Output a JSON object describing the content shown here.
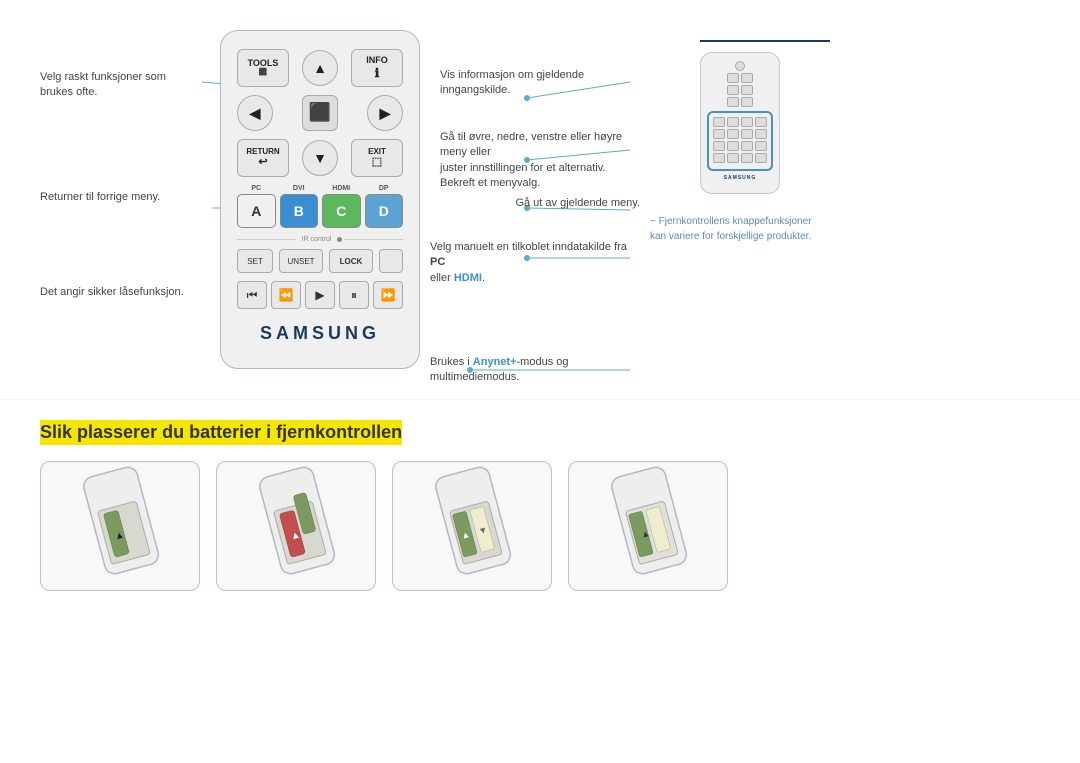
{
  "page": {
    "background": "#ffffff"
  },
  "remote": {
    "tools_label": "TOOLS",
    "info_label": "INFO",
    "return_label": "RETURN",
    "exit_label": "EXIT",
    "samsung_logo": "SAMSUNG",
    "ir_label": "IR control",
    "set_label": "SET",
    "unset_label": "UNSET",
    "lock_label": "LOCK",
    "color_buttons": [
      {
        "label": "PC",
        "letter": "A"
      },
      {
        "label": "DVI",
        "letter": "B"
      },
      {
        "label": "HDMI",
        "letter": "C"
      },
      {
        "label": "DP",
        "letter": "D"
      }
    ]
  },
  "annotations": [
    {
      "id": "tools",
      "text": "Velg raskt funksjoner som brukes ofte."
    },
    {
      "id": "info",
      "text": "Vis informasjon om gjeldende inngangskilde."
    },
    {
      "id": "navigate",
      "text": "Gå til øvre, nedre, venstre eller høyre meny eller\njuster innstillingen for et alternativ.\nBekreft et menyvalg."
    },
    {
      "id": "exit",
      "text": "Gå ut av gjeldende meny."
    },
    {
      "id": "return",
      "text": "Returner til forrige meny."
    },
    {
      "id": "source",
      "text": "Velg manuelt en tilkoblet inndatakilde fra "
    },
    {
      "id": "source_pc",
      "text": "PC"
    },
    {
      "id": "source_or",
      "text": " eller "
    },
    {
      "id": "source_hdmi",
      "text": "HDMI"
    },
    {
      "id": "lock",
      "text": "Det angir sikker låsefunksjon."
    },
    {
      "id": "anynet",
      "text": "Brukes i "
    },
    {
      "id": "anynet_bold",
      "text": "Anynet+"
    },
    {
      "id": "anynet_rest",
      "text": "-modus og multimediemodus."
    }
  ],
  "footnote": {
    "dash": "−",
    "text": "Fjernkontrollens knappefunksjoner kan variere for forskjellige produkter."
  },
  "battery_section": {
    "title": "Slik plasserer du batterier i fjernkontrollen"
  }
}
